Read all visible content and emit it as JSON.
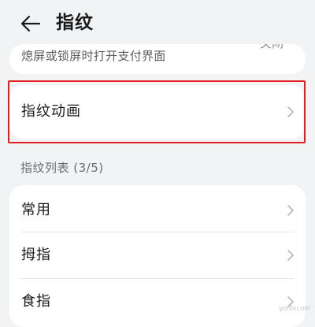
{
  "header": {
    "title": "指纹"
  },
  "top_card": {
    "description": "熄屏或锁屏时打开支付界面",
    "value": "关闭"
  },
  "animation_row": {
    "label": "指纹动画"
  },
  "fingerprint_list": {
    "section_title": "指纹列表 (3/5)",
    "items": [
      {
        "label": "常用"
      },
      {
        "label": "拇指"
      },
      {
        "label": "食指"
      }
    ]
  },
  "watermark": "yonhu.net",
  "icons": {
    "back": "arrow-left-icon",
    "chevron": "chevron-right-icon"
  },
  "colors": {
    "background": "#f1f3f5",
    "card": "#ffffff",
    "highlight": "#e02020"
  }
}
